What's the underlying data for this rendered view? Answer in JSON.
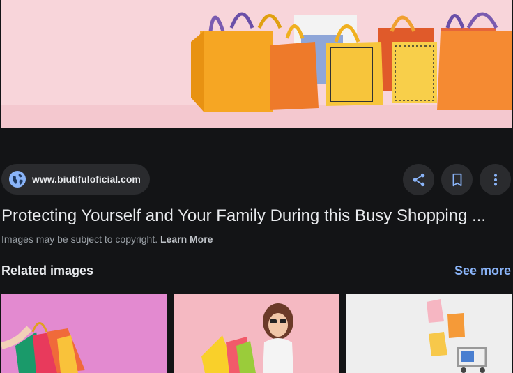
{
  "hero": {
    "alt": "shopping-bags-image"
  },
  "source": {
    "site": "www.biutifuloficial.com"
  },
  "actions": {
    "share": "share-icon",
    "save": "bookmark-icon",
    "more": "more-vert-icon"
  },
  "result": {
    "title": "Protecting Yourself and Your Family During this Busy Shopping ...",
    "copyright_text": "Images may be subject to copyright.",
    "learn_more": "Learn More"
  },
  "related": {
    "heading": "Related images",
    "see_more": "See more"
  },
  "colors": {
    "background": "#131416",
    "accent": "#8ab4f8",
    "pill": "#2a2b2e"
  }
}
